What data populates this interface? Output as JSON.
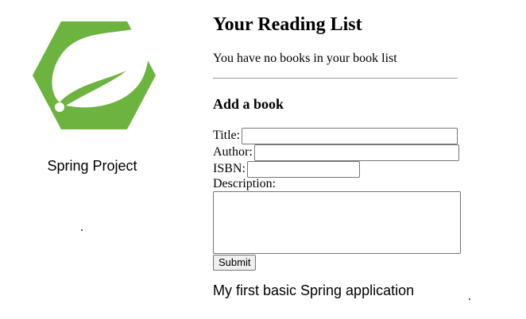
{
  "sidebar": {
    "logo_icon": "spring-leaf-hexagon-logo",
    "logo_color": "#6db33f",
    "project_name": "Spring Project"
  },
  "main": {
    "title": "Your Reading List",
    "empty_message": "You have no books in your book list",
    "form": {
      "heading": "Add a book",
      "title_label": "Title:",
      "title_value": "",
      "author_label": "Author:",
      "author_value": "",
      "isbn_label": "ISBN:",
      "isbn_value": "",
      "description_label": "Description:",
      "description_value": "",
      "submit_label": "Submit"
    },
    "footer_text": "My first basic Spring application"
  }
}
